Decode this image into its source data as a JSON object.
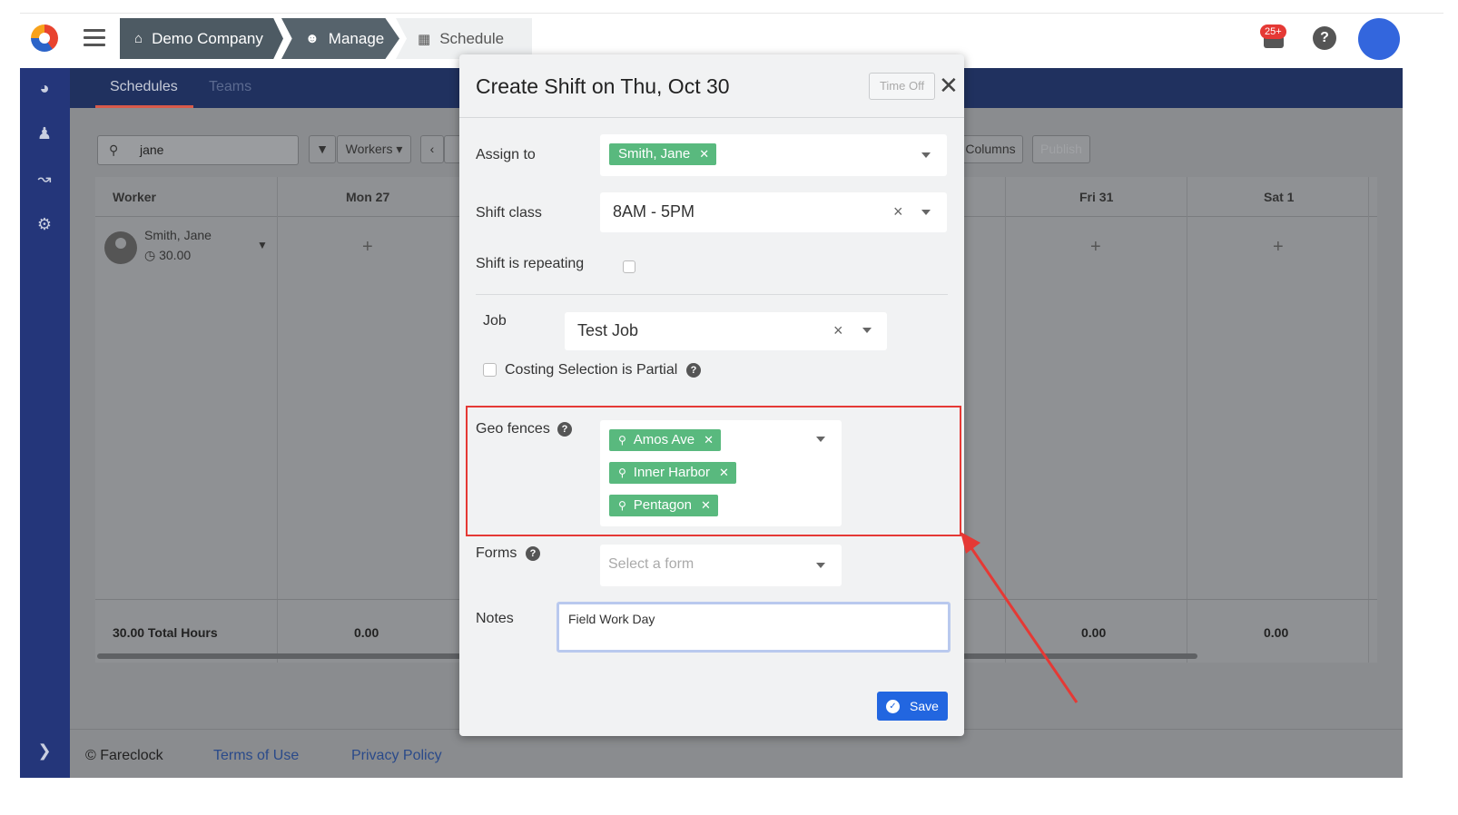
{
  "topbar": {
    "breadcrumbs": [
      {
        "label": "Demo Company",
        "icon": "home-icon"
      },
      {
        "label": "Manage",
        "icon": "user-icon"
      },
      {
        "label": "Schedule",
        "icon": "calendar-icon"
      }
    ],
    "notification_badge": "25+"
  },
  "subnav": {
    "tabs": [
      "Schedules",
      "Teams"
    ]
  },
  "toolbar": {
    "search_value": "jane",
    "workers_label": "Workers",
    "columns_label": "Columns",
    "publish_label": "Publish"
  },
  "grid": {
    "header_worker": "Worker",
    "days": [
      "Mon 27",
      "Fri 31",
      "Sat 1"
    ],
    "worker": {
      "name": "Smith, Jane",
      "hours": "30.00"
    },
    "total_label": "30.00 Total Hours",
    "totals": [
      "0.00",
      "0.00",
      "0.00"
    ]
  },
  "footer": {
    "copyright": "© Fareclock",
    "terms": "Terms of Use",
    "privacy": "Privacy Policy"
  },
  "modal": {
    "title": "Create Shift on Thu, Oct 30",
    "time_off_label": "Time Off",
    "assign_label": "Assign to",
    "assign_tag": "Smith, Jane",
    "shift_class_label": "Shift class",
    "shift_class_value": "8AM - 5PM",
    "repeating_label": "Shift is repeating",
    "job_label": "Job",
    "job_value": "Test Job",
    "costing_label": "Costing Selection is Partial",
    "geo_label": "Geo fences",
    "geo_tags": [
      "Amos Ave",
      "Inner Harbor",
      "Pentagon"
    ],
    "forms_label": "Forms",
    "forms_placeholder": "Select a form",
    "notes_label": "Notes",
    "notes_value": "Field Work Day",
    "save_label": "Save"
  },
  "colors": {
    "sidebar": "#24367a",
    "tag_green": "#59b97e",
    "save_blue": "#2266e0",
    "highlight_red": "#e53935"
  }
}
